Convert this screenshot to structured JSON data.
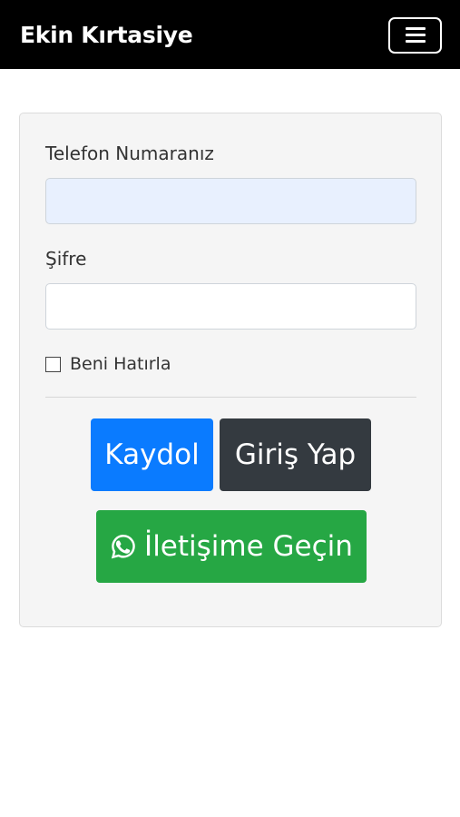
{
  "navbar": {
    "brand": "Ekin Kırtasiye",
    "menu_icon": "hamburger-menu-icon"
  },
  "form": {
    "phone_label": "Telefon Numaranız",
    "phone_value": "",
    "password_label": "Şifre",
    "password_value": "",
    "remember_label": "Beni Hatırla",
    "remember_checked": false
  },
  "buttons": {
    "register": "Kaydol",
    "login": "Giriş Yap",
    "contact": "İletişime Geçin",
    "contact_icon": "whatsapp-icon"
  },
  "colors": {
    "navbar_bg": "#000000",
    "register_bg": "#0a7bff",
    "login_bg": "#343a40",
    "contact_bg": "#26a744",
    "phone_autofill_bg": "#e8f0fe"
  }
}
